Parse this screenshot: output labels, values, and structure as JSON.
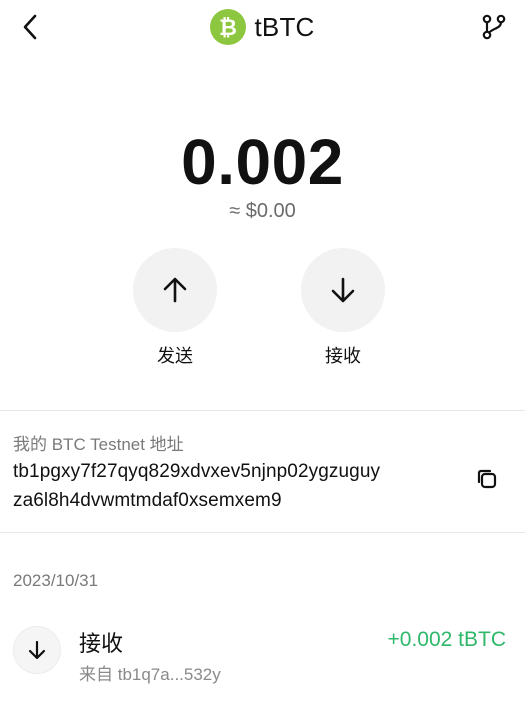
{
  "header": {
    "title": "tBTC",
    "back_icon": "chevron-left-icon",
    "menu_icon": "git-branch-icon",
    "logo": {
      "icon": "bitcoin-icon",
      "color": "#8dc63f",
      "glyph": "₿"
    }
  },
  "balance": {
    "amount": "0.002",
    "fiat": "≈ $0.00"
  },
  "actions": {
    "send": {
      "label": "发送",
      "icon": "arrow-up-icon"
    },
    "receive": {
      "label": "接收",
      "icon": "arrow-down-icon"
    }
  },
  "address": {
    "label": "我的 BTC Testnet 地址",
    "line1": "tb1pgxy7f27qyq829xdvxev5njnp02ygzuguy",
    "line2": "za6l8h4dvwmtmdaf0xsemxem9",
    "copy_icon": "copy-icon"
  },
  "history": {
    "date": "2023/10/31",
    "transactions": [
      {
        "type": "接收",
        "from": "来自 tb1q7a...532y",
        "amount": "+0.002 tBTC",
        "icon": "arrow-down-icon",
        "amount_color": "#2fb86a"
      }
    ]
  }
}
